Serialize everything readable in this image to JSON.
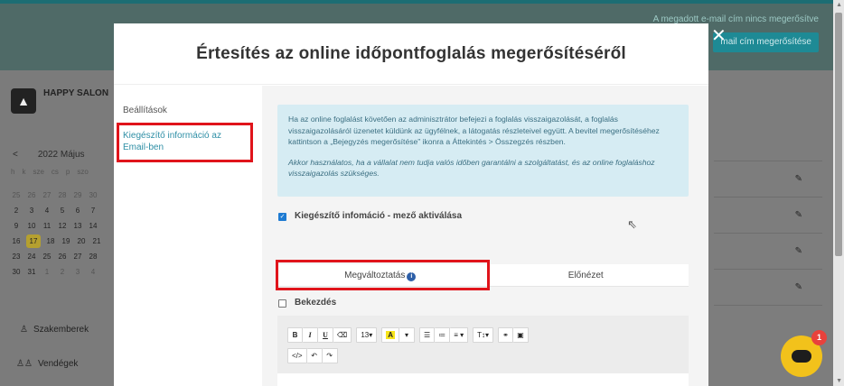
{
  "background": {
    "warning_text": "A megadott e-mail cím nincs megerősítve",
    "verify_button": "mail cím megerősítése",
    "salon_name": "HAPPY SALON",
    "calendar": {
      "prev": "<",
      "month": "2022 Május",
      "days_of_week": [
        "h",
        "k",
        "sze",
        "cs",
        "p",
        "szo"
      ],
      "weeks": [
        [
          "25",
          "26",
          "27",
          "28",
          "29",
          "30"
        ],
        [
          "2",
          "3",
          "4",
          "5",
          "6",
          "7"
        ],
        [
          "9",
          "10",
          "11",
          "12",
          "13",
          "14"
        ],
        [
          "16",
          "17",
          "18",
          "19",
          "20",
          "21"
        ],
        [
          "23",
          "24",
          "25",
          "26",
          "27",
          "28"
        ],
        [
          "30",
          "31",
          "1",
          "2",
          "3",
          "4"
        ]
      ],
      "today": "17"
    },
    "nav": [
      {
        "icon": "person-icon",
        "label": "Szakemberek"
      },
      {
        "icon": "people-icon",
        "label": "Vendégek"
      }
    ]
  },
  "modal": {
    "title": "Értesítés az online időpontfoglalás megerősítéséről",
    "close_label": "✕",
    "sidebar": {
      "items": [
        {
          "label": "Beállítások"
        },
        {
          "label": "Kiegészítő információ az Email-ben"
        }
      ]
    },
    "info": {
      "paragraph1": "Ha az online foglalást követően az adminisztrátor befejezi a foglalás visszaigazolását, a foglalás visszaigazolásáról üzenetet küldünk az ügyfélnek, a látogatás részleteivel együtt. A bevitel megerősítéséhez kattintson a „Bejegyzés megerősítése” ikonra a Áttekintés > Összegzés részben.",
      "paragraph2": "Akkor használatos, ha a vállalat nem tudja valós időben garantálni a szolgáltatást, és az online foglaláshoz visszaigazolás szükséges."
    },
    "activate_checkbox": {
      "label": "Kiegészítő infomáció - mező aktiválása",
      "checked": true
    },
    "tabs": [
      {
        "label": "Megváltoztatás",
        "active": true
      },
      {
        "label": "Előnézet",
        "active": false
      }
    ],
    "intro_checkbox": {
      "label": "Bekezdés",
      "checked": false
    },
    "toolbar": {
      "row1": {
        "bold": "B",
        "italic": "I",
        "underline": "U",
        "eraser": "⌫",
        "font_size": "13▾",
        "highlight": "A",
        "highlight_caret": "▾",
        "bullets": "☰",
        "numbers": "≔",
        "align": "≡ ▾",
        "line_height": "T↕▾",
        "link": "⚭",
        "image": "▣"
      },
      "row2": {
        "code": "</>",
        "undo": "↶",
        "redo": "↷"
      }
    }
  },
  "chat": {
    "badge": "1"
  },
  "colors": {
    "accent": "#2f8fa6",
    "highlight_box": "#e0141b",
    "info_bg": "#d6ecf3",
    "chat": "#f2c21b"
  }
}
